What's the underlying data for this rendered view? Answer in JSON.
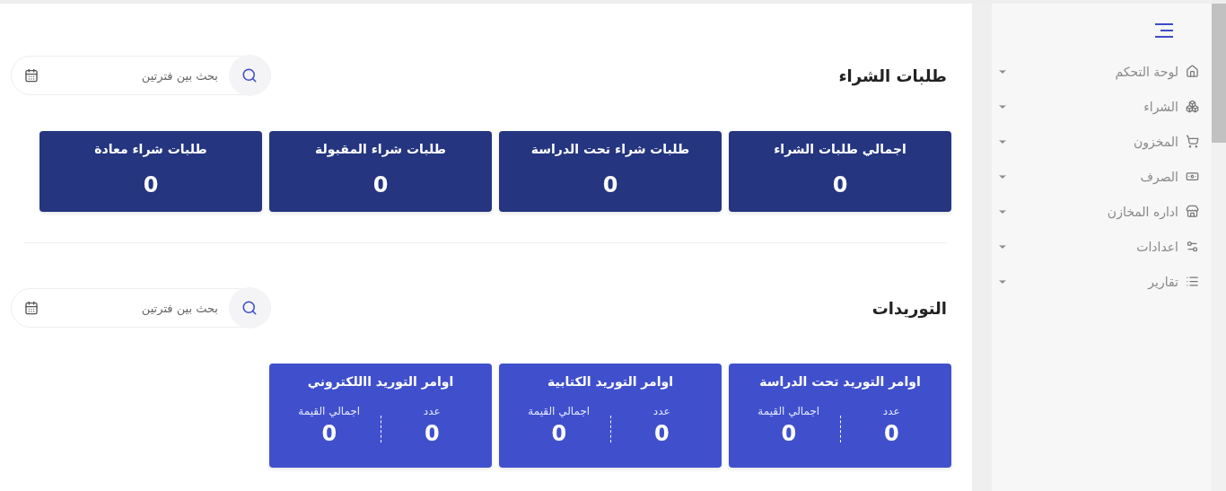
{
  "sections": [
    {
      "title": "طلبات الشراء",
      "search": {
        "placeholder": "بحث بين فترتين"
      },
      "cards": [
        {
          "kind": "total",
          "title": "اجمالي طلبات الشراء",
          "value": "0"
        },
        {
          "kind": "total",
          "title": "طلبات شراء تحت الدراسة",
          "value": "0"
        },
        {
          "kind": "total",
          "title": "طلبات شراء المقبولة",
          "value": "0"
        },
        {
          "kind": "total",
          "title": "طلبات شراء معادة",
          "value": "0"
        }
      ]
    },
    {
      "title": "التوريدات",
      "search": {
        "placeholder": "بحث بين فترتين"
      },
      "cards": [
        {
          "kind": "split",
          "title": "اوامر التوريد تحت الدراسة",
          "count_label": "عدد",
          "count": "0",
          "amount_label": "اجمالي القيمة",
          "amount": "0"
        },
        {
          "kind": "split",
          "title": "اوامر التوريد الكتابية",
          "count_label": "عدد",
          "count": "0",
          "amount_label": "اجمالي القيمة",
          "amount": "0"
        },
        {
          "kind": "split",
          "title": "اوامر التوريد االلكتروني",
          "count_label": "عدد",
          "count": "0",
          "amount_label": "اجمالي القيمة",
          "amount": "0"
        }
      ]
    }
  ],
  "sidebar": {
    "items": [
      {
        "label": "لوحة التحكم"
      },
      {
        "label": "الشراء"
      },
      {
        "label": "المخزون"
      },
      {
        "label": "الصرف"
      },
      {
        "label": "اداره المخازن"
      },
      {
        "label": "اعدادات"
      },
      {
        "label": "تقارير"
      }
    ]
  }
}
